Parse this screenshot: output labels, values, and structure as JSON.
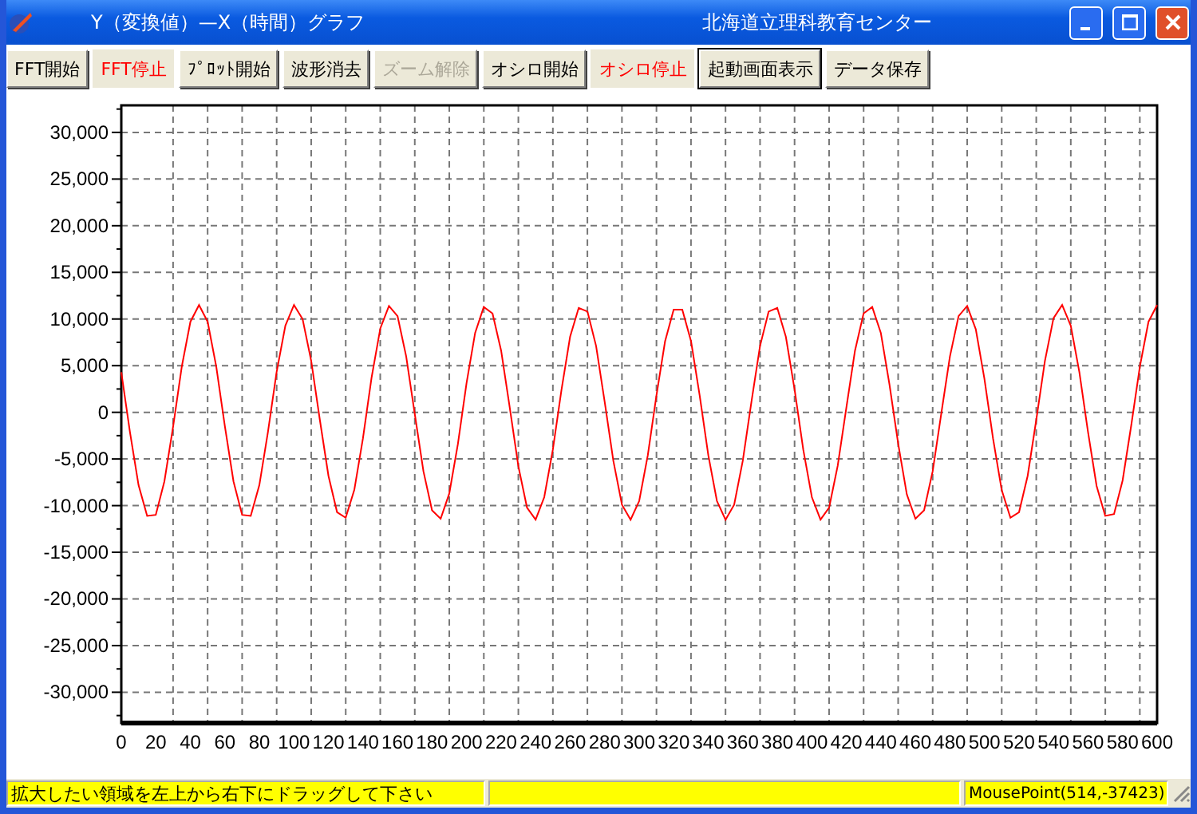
{
  "window": {
    "title": "Y（変換値）—X（時間）グラフ",
    "org": "北海道立理科教育センター"
  },
  "toolbar": [
    {
      "label": "FFT開始",
      "active": false,
      "disabled": false,
      "focused": false
    },
    {
      "label": "FFT停止",
      "active": true,
      "disabled": false,
      "focused": false
    },
    {
      "label": "ﾌﾟﾛｯﾄ開始",
      "active": false,
      "disabled": false,
      "focused": false
    },
    {
      "label": "波形消去",
      "active": false,
      "disabled": false,
      "focused": false
    },
    {
      "label": "ズーム解除",
      "active": false,
      "disabled": true,
      "focused": false
    },
    {
      "label": "オシロ開始",
      "active": false,
      "disabled": false,
      "focused": false
    },
    {
      "label": "オシロ停止",
      "active": true,
      "disabled": false,
      "focused": false
    },
    {
      "label": "起動画面表示",
      "active": false,
      "disabled": false,
      "focused": true
    },
    {
      "label": "データ保存",
      "active": false,
      "disabled": false,
      "focused": false
    }
  ],
  "chart_data": {
    "type": "line",
    "grid": true,
    "xlim": [
      0,
      600
    ],
    "ylim": [
      -33300,
      32900
    ],
    "xticks": [
      0,
      20,
      40,
      60,
      80,
      100,
      120,
      140,
      160,
      180,
      200,
      220,
      240,
      260,
      280,
      300,
      320,
      340,
      360,
      380,
      400,
      420,
      440,
      460,
      480,
      500,
      520,
      540,
      560,
      580,
      600
    ],
    "yticks": [
      {
        "value": 30000,
        "label": "30,000"
      },
      {
        "value": 25000,
        "label": "25,000"
      },
      {
        "value": 20000,
        "label": "20,000"
      },
      {
        "value": 15000,
        "label": "15,000"
      },
      {
        "value": 10000,
        "label": "10,000"
      },
      {
        "value": 5000,
        "label": "5,000"
      },
      {
        "value": 0,
        "label": "0"
      },
      {
        "value": -5000,
        "label": "-5,000"
      },
      {
        "value": -10000,
        "label": "-10,000"
      },
      {
        "value": -15000,
        "label": "-15,000"
      },
      {
        "value": -20000,
        "label": "-20,000"
      },
      {
        "value": -25000,
        "label": "-25,000"
      },
      {
        "value": -30000,
        "label": "-30,000"
      }
    ],
    "x": [
      0,
      5,
      10,
      15,
      20,
      25,
      30,
      35,
      40,
      45,
      50,
      55,
      60,
      65,
      70,
      75,
      80,
      85,
      90,
      95,
      100,
      105,
      110,
      115,
      120,
      125,
      130,
      135,
      140,
      145,
      150,
      155,
      160,
      165,
      170,
      175,
      180,
      185,
      190,
      195,
      200,
      205,
      210,
      215,
      220,
      225,
      230,
      235,
      240,
      245,
      250,
      255,
      260,
      265,
      270,
      275,
      280,
      285,
      290,
      295,
      300,
      305,
      310,
      315,
      320,
      325,
      330,
      335,
      340,
      345,
      350,
      355,
      360,
      365,
      370,
      375,
      380,
      385,
      390,
      395,
      400,
      405,
      410,
      415,
      420,
      425,
      430,
      435,
      440,
      445,
      450,
      455,
      460,
      465,
      470,
      475,
      480,
      485,
      490,
      495,
      500,
      505,
      510,
      515,
      520,
      525,
      530,
      535,
      540,
      545,
      550,
      555,
      560,
      565,
      570,
      575,
      580,
      585,
      590,
      595,
      600
    ],
    "series": [
      {
        "color": "#ff0000",
        "values": [
          4300,
          -2100,
          -7800,
          -11100,
          -11000,
          -7400,
          -1500,
          4900,
          9700,
          11500,
          9700,
          4900,
          -1500,
          -7400,
          -11000,
          -11100,
          -7800,
          -2100,
          4300,
          9300,
          11500,
          10000,
          5500,
          -800,
          -6800,
          -10700,
          -11300,
          -8300,
          -2800,
          3700,
          9000,
          11400,
          10300,
          6000,
          -200,
          -6300,
          -10500,
          -11400,
          -8700,
          -3400,
          3100,
          8500,
          11300,
          10600,
          6600,
          500,
          -5800,
          -10200,
          -11500,
          -9100,
          -4000,
          2400,
          8100,
          11200,
          10800,
          7100,
          1100,
          -5200,
          -9900,
          -11500,
          -9500,
          -4600,
          1800,
          7600,
          11000,
          11000,
          7600,
          1800,
          -4600,
          -9500,
          -11500,
          -9900,
          -5200,
          1100,
          7100,
          10800,
          11200,
          8100,
          2400,
          -4000,
          -9100,
          -11500,
          -10200,
          -5700,
          500,
          6600,
          10600,
          11300,
          8500,
          3000,
          -3400,
          -8800,
          -11400,
          -10500,
          -6300,
          -100,
          6000,
          10300,
          11400,
          8900,
          3600,
          -2800,
          -8300,
          -11300,
          -10700,
          -6800,
          -800,
          5500,
          10100,
          11500,
          9300,
          4300,
          -2100,
          -7900,
          -11100,
          -10900,
          -7300,
          -1400,
          4900,
          9700,
          11500
        ]
      }
    ]
  },
  "status_bar": {
    "hint": "拡大したい領域を左上から右下にドラッグして下さい",
    "mouse": "MousePoint(514,-37423)"
  }
}
